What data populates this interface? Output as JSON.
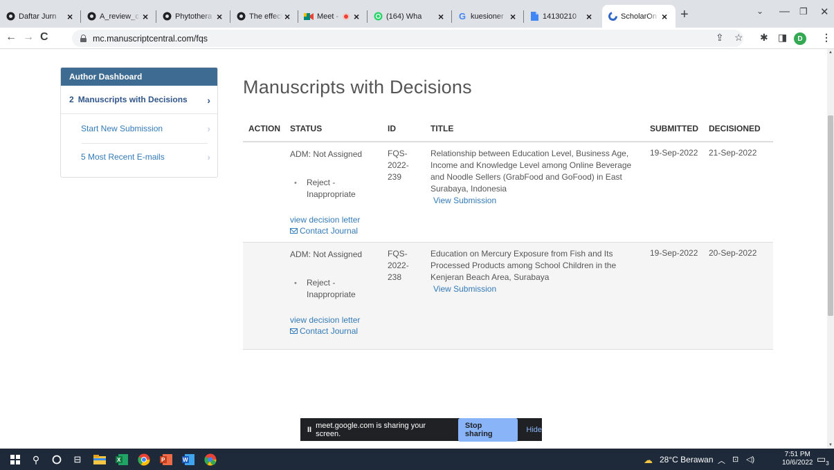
{
  "browser": {
    "tabs": [
      {
        "title": "Daftar Jurn"
      },
      {
        "title": "A_review_c"
      },
      {
        "title": "Phytothera"
      },
      {
        "title": "The effect"
      },
      {
        "title": "Meet -"
      },
      {
        "title": "(164) Wha"
      },
      {
        "title": "kuesioner"
      },
      {
        "title": "14130210"
      },
      {
        "title": "ScholarOn"
      }
    ],
    "url": "mc.manuscriptcentral.com/fqs",
    "profile_initial": "D"
  },
  "sidebar": {
    "header": "Author Dashboard",
    "items": [
      {
        "count": "2",
        "label": "Manuscripts with Decisions"
      },
      {
        "label": "Start New Submission"
      },
      {
        "label": "5 Most Recent E-mails"
      }
    ]
  },
  "main": {
    "title": "Manuscripts with Decisions",
    "columns": [
      "ACTION",
      "STATUS",
      "ID",
      "TITLE",
      "SUBMITTED",
      "DECISIONED"
    ],
    "rows": [
      {
        "status_admin": "ADM: Not Assigned",
        "decision": "Reject - Inappropriate",
        "decision_letter_link": "view decision letter",
        "contact_link": "Contact Journal",
        "id": "FQS-2022-239",
        "title": "Relationship between Education Level, Business Age, Income and Knowledge Level among Online Beverage and Noodle Sellers (GrabFood and GoFood) in East Surabaya, Indonesia",
        "view_link": "View Submission",
        "submitted": "19-Sep-2022",
        "decisioned": "21-Sep-2022"
      },
      {
        "status_admin": "ADM: Not Assigned",
        "decision": "Reject - Inappropriate",
        "decision_letter_link": "view decision letter",
        "contact_link": "Contact Journal",
        "id": "FQS-2022-238",
        "title": "Education on Mercury Exposure from Fish and Its Processed Products among School Children in the Kenjeran Beach Area, Surabaya",
        "view_link": "View Submission",
        "submitted": "19-Sep-2022",
        "decisioned": "20-Sep-2022"
      }
    ]
  },
  "share_bar": {
    "message": "meet.google.com is sharing your screen.",
    "stop_label": "Stop sharing",
    "hide_label": "Hide"
  },
  "taskbar": {
    "weather": "28°C Berawan",
    "time": "7:51 PM",
    "date": "10/6/2022",
    "notification_count": "3"
  },
  "colors": {
    "dashboard_header": "#3e6b92",
    "link": "#337ab7",
    "share_button": "#8ab4f8",
    "taskbar": "#1e2a3a"
  }
}
